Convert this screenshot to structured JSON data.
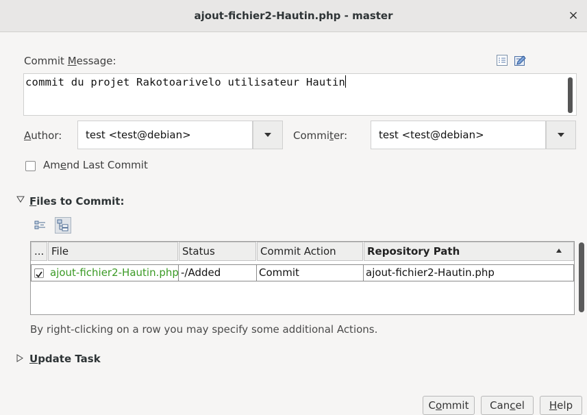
{
  "window": {
    "title": "ajout-fichier2-Hautin.php - master",
    "close_glyph": "×"
  },
  "commit_message": {
    "label_pre": "Commit ",
    "label_u": "M",
    "label_post": "essage:",
    "value": "commit du projet Rakotoarivelo utilisateur Hautin"
  },
  "author": {
    "label_u": "A",
    "label_post": "uthor:",
    "value": "test <test@debian>"
  },
  "committer": {
    "label_pre": "Commi",
    "label_u": "t",
    "label_post": "er:",
    "value": "test <test@debian>"
  },
  "amend": {
    "label_pre": "Am",
    "label_u": "e",
    "label_post": "nd Last Commit",
    "checked": false
  },
  "files_section": {
    "label_u": "F",
    "label_post": "iles to Commit:",
    "expanded": true
  },
  "table": {
    "columns": [
      {
        "label": "..."
      },
      {
        "label": "File"
      },
      {
        "label": "Status"
      },
      {
        "label": "Commit Action"
      },
      {
        "label": "Repository Path",
        "sorted": "ascending"
      }
    ],
    "rows": [
      {
        "checked": true,
        "file": "ajout-fichier2-Hautin.php",
        "status": "-/Added",
        "action": "Commit",
        "path": "ajout-fichier2-Hautin.php"
      }
    ]
  },
  "hint": "By right-clicking on a row you may specify some additional Actions.",
  "update_task": {
    "label_u": "U",
    "label_post": "pdate Task",
    "expanded": false
  },
  "buttons": {
    "commit_pre": "C",
    "commit_u": "o",
    "commit_post": "mmit",
    "cancel_pre": "Can",
    "cancel_u": "c",
    "cancel_post": "el",
    "help_u": "H",
    "help_post": "elp"
  },
  "colors": {
    "added_file": "#3a9a24",
    "background": "#f6f5f4"
  }
}
